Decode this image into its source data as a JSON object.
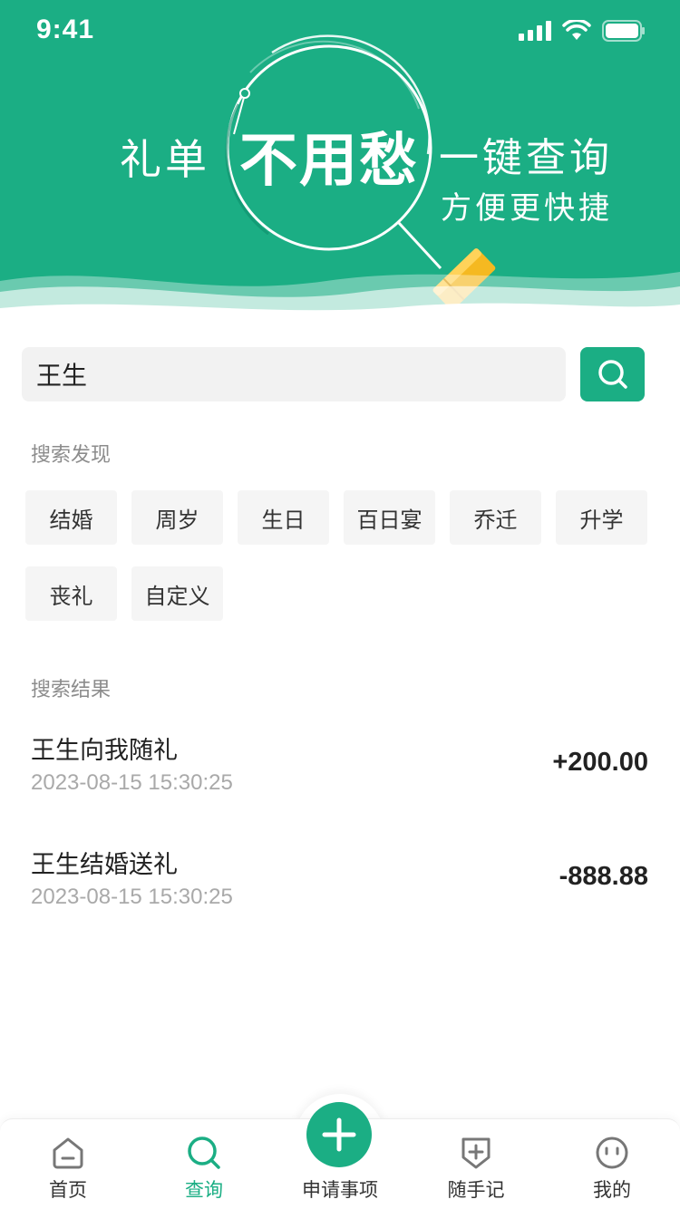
{
  "status_bar": {
    "time": "9:41"
  },
  "hero": {
    "text_left": "礼单",
    "text_center": "不用愁",
    "text_right_line1": "一键查询",
    "text_right_line2": "方便更快捷"
  },
  "search": {
    "value": "王生",
    "button_icon": "search-icon"
  },
  "discover": {
    "title": "搜索发现",
    "tags": [
      "结婚",
      "周岁",
      "生日",
      "百日宴",
      "乔迁",
      "升学",
      "丧礼",
      "自定义"
    ]
  },
  "results": {
    "title": "搜索结果",
    "items": [
      {
        "title": "王生向我随礼",
        "time": "2023-08-15   15:30:25",
        "amount": "+200.00"
      },
      {
        "title": "王生结婚送礼",
        "time": "2023-08-15   15:30:25",
        "amount": "-888.88"
      }
    ]
  },
  "tabbar": {
    "home": "首页",
    "query": "查询",
    "apply": "申请事项",
    "notes": "随手记",
    "mine": "我的"
  },
  "colors": {
    "brand": "#1bae84",
    "accent_yellow": "#f5b921"
  }
}
